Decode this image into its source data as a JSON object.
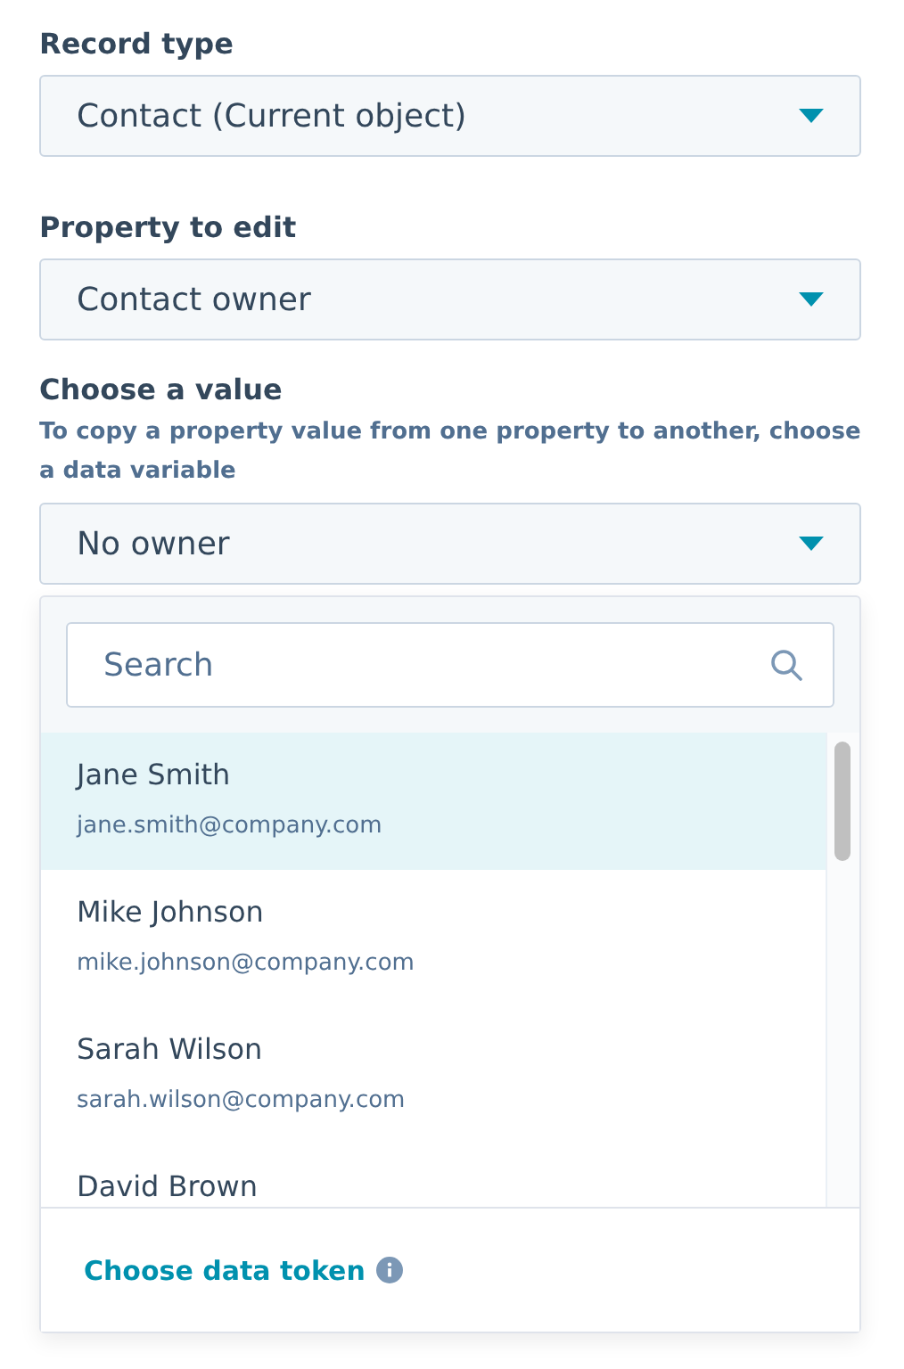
{
  "fields": [
    {
      "label": "Record type",
      "value": "Contact (Current object)"
    },
    {
      "label": "Property to edit",
      "value": "Contact owner"
    },
    {
      "label": "Choose a value",
      "help": "To copy a property value from one property to another, choose a data variable",
      "value": "No owner"
    }
  ],
  "dropdown": {
    "search": {
      "placeholder": "Search"
    },
    "options": [
      {
        "name": "Jane Smith",
        "email": "jane.smith@company.com",
        "selected": true
      },
      {
        "name": "Mike Johnson",
        "email": "mike.johnson@company.com",
        "selected": false
      },
      {
        "name": "Sarah Wilson",
        "email": "sarah.wilson@company.com",
        "selected": false
      },
      {
        "name": "David Brown",
        "selected": false
      }
    ],
    "footer_link": "Choose data token"
  }
}
